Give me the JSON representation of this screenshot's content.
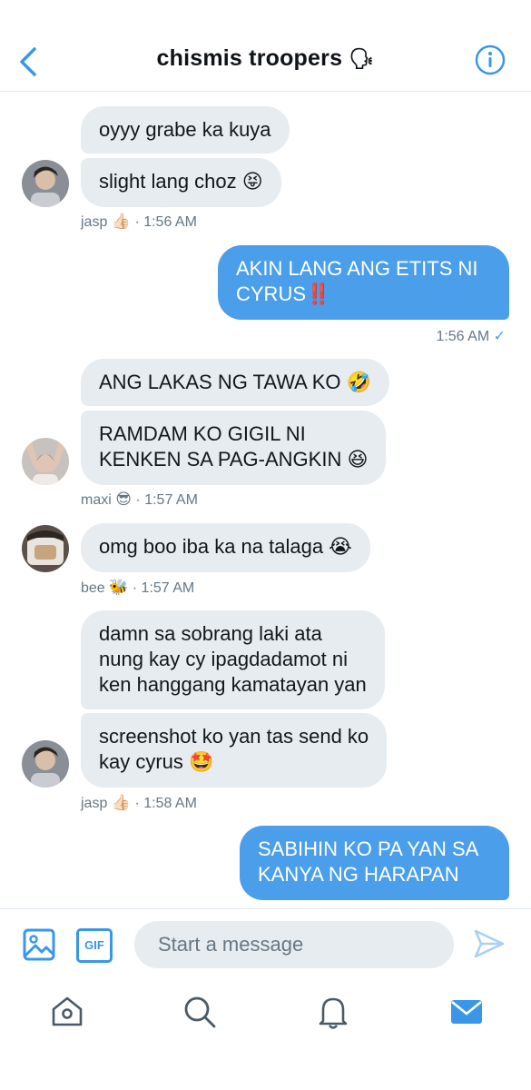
{
  "header": {
    "title": "chismis troopers",
    "title_emoji": "🗣",
    "back_icon": "chevron-left-icon",
    "info_icon": "info-icon"
  },
  "messages": [
    {
      "sender": "jasp",
      "text": "oyyy grabe ka kuya"
    },
    {
      "sender": "jasp",
      "text": "slight lang choz 😝"
    },
    {
      "sender": "me",
      "text": "AKIN LANG ANG ETITS NI CYRUS‼️"
    },
    {
      "sender": "maxi",
      "text": "ANG LAKAS NG TAWA KO 🤣"
    },
    {
      "sender": "maxi",
      "text": "RAMDAM KO GIGIL NI\nKENKEN SA PAG-ANGKIN 😆"
    },
    {
      "sender": "bee",
      "text": "omg boo iba ka na talaga 😭"
    },
    {
      "sender": "jasp",
      "text": "damn sa sobrang laki ata\nnung kay cy ipagdadamot ni\nken hanggang kamatayan yan"
    },
    {
      "sender": "jasp",
      "text": "screenshot ko yan tas send ko\nkay cyrus 🤩"
    },
    {
      "sender": "me",
      "text": "SABIHIN KO PA YAN SA\nKANYA NG HARAPAN"
    }
  ],
  "meta": {
    "m1_name": "jasp",
    "m1_emoji": "👍🏻",
    "m1_time": "· 1:56 AM",
    "me1_time": "1:56 AM",
    "me1_check": "✓",
    "m2_name": "maxi",
    "m2_emoji": "😎",
    "m2_time": "· 1:57 AM",
    "m3_name": "bee",
    "m3_emoji": "🐝",
    "m3_time": "· 1:57 AM",
    "m4_name": "jasp",
    "m4_emoji": "👍🏻",
    "m4_time": "· 1:58 AM"
  },
  "composer": {
    "placeholder": "Start a message",
    "gif_label": "GIF"
  },
  "tabbar": {
    "icons": [
      "home-icon",
      "search-icon",
      "notifications-icon",
      "messages-icon"
    ]
  },
  "colors": {
    "accent": "#4a9eea",
    "bubble_received": "#e6ecf0",
    "meta_text": "#657786"
  }
}
